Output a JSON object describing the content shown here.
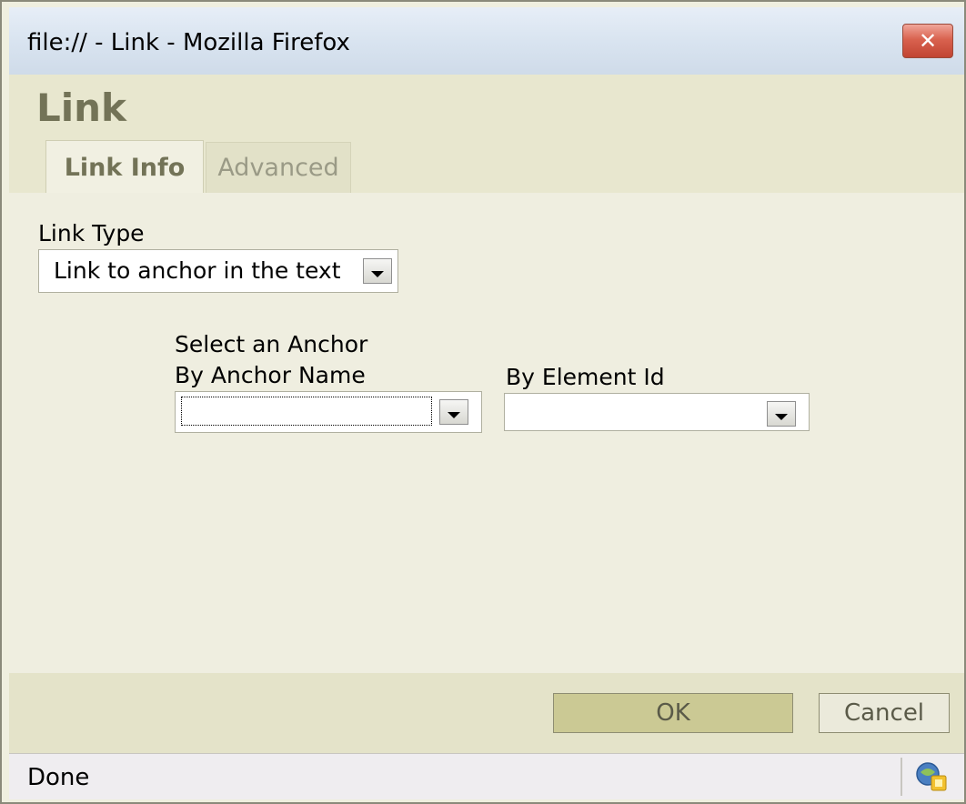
{
  "window": {
    "title": "file:// - Link - Mozilla Firefox",
    "close_label": "✕"
  },
  "dialog": {
    "title": "Link",
    "tabs": [
      {
        "label": "Link Info",
        "active": true
      },
      {
        "label": "Advanced",
        "active": false
      }
    ]
  },
  "link_info": {
    "link_type_label": "Link Type",
    "link_type_value": "Link to anchor in the text",
    "select_anchor_label": "Select an Anchor",
    "by_anchor_name_label": "By Anchor Name",
    "by_anchor_name_value": "",
    "by_element_id_label": "By Element Id",
    "by_element_id_value": ""
  },
  "buttons": {
    "ok": "OK",
    "cancel": "Cancel"
  },
  "status": {
    "text": "Done",
    "icon": "security-status-icon"
  },
  "colors": {
    "header_title": "#737357",
    "ok_button_bg": "#cbc994",
    "close_button": "#d9624f"
  }
}
